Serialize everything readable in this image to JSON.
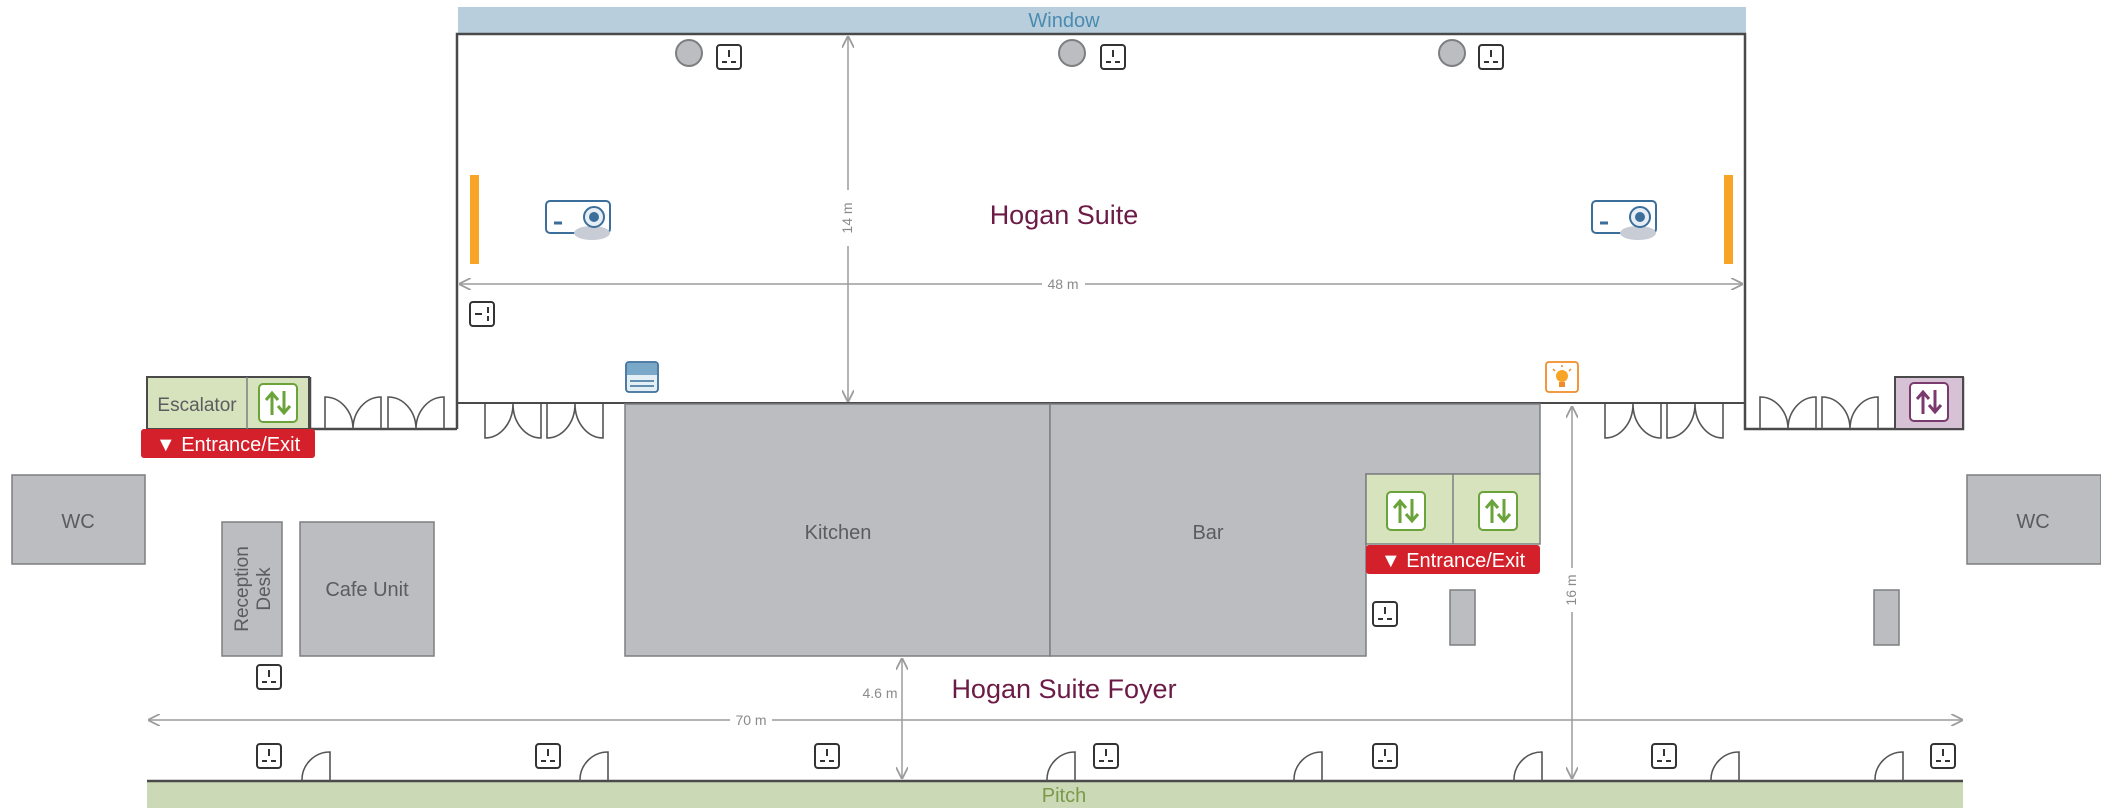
{
  "labels": {
    "window": "Window",
    "pitch": "Pitch",
    "hogan_suite": "Hogan Suite",
    "hogan_suite_foyer": "Hogan Suite Foyer",
    "kitchen": "Kitchen",
    "bar": "Bar",
    "escalator": "Escalator",
    "entrance_exit_left": "▼ Entrance/Exit",
    "entrance_exit_right": "▼ Entrance/Exit",
    "wc_left": "WC",
    "wc_right": "WC",
    "reception_line1": "Reception",
    "reception_line2": "Desk",
    "cafe_unit": "Cafe Unit"
  },
  "dimensions": {
    "suite_width": "48 m",
    "suite_depth": "14 m",
    "foyer_width": "70 m",
    "foyer_depth": "16 m",
    "kitchen_clearance": "4.6 m"
  },
  "colors": {
    "window_band": "#b9cedc",
    "window_text": "#4a8bb0",
    "pitch_band": "#cbd9b6",
    "pitch_text": "#7a9a4a",
    "room_fill": "#bcbdc0",
    "room_stroke": "#7d7e81",
    "room_text": "#5b5c5f",
    "title_text": "#6b1b45",
    "entrance_red": "#d4202a",
    "lift_green": "#6aa33a",
    "lift_bg": "#d6e3bd",
    "lift_purple": "#7a3a6e",
    "lift_purple_bg": "#d7c2d5",
    "stage_orange": "#f7a427",
    "projector_blue": "#3b6e9a",
    "dim_line": "#9c9c9c",
    "wall": "#4a4a4a"
  },
  "icons": [
    "socket-icon",
    "ceiling-light-icon",
    "projector-icon",
    "lift-icon",
    "door-swing-icon",
    "screen-bar-icon",
    "light-bulb-icon",
    "window-blind-icon",
    "switch-icon"
  ]
}
